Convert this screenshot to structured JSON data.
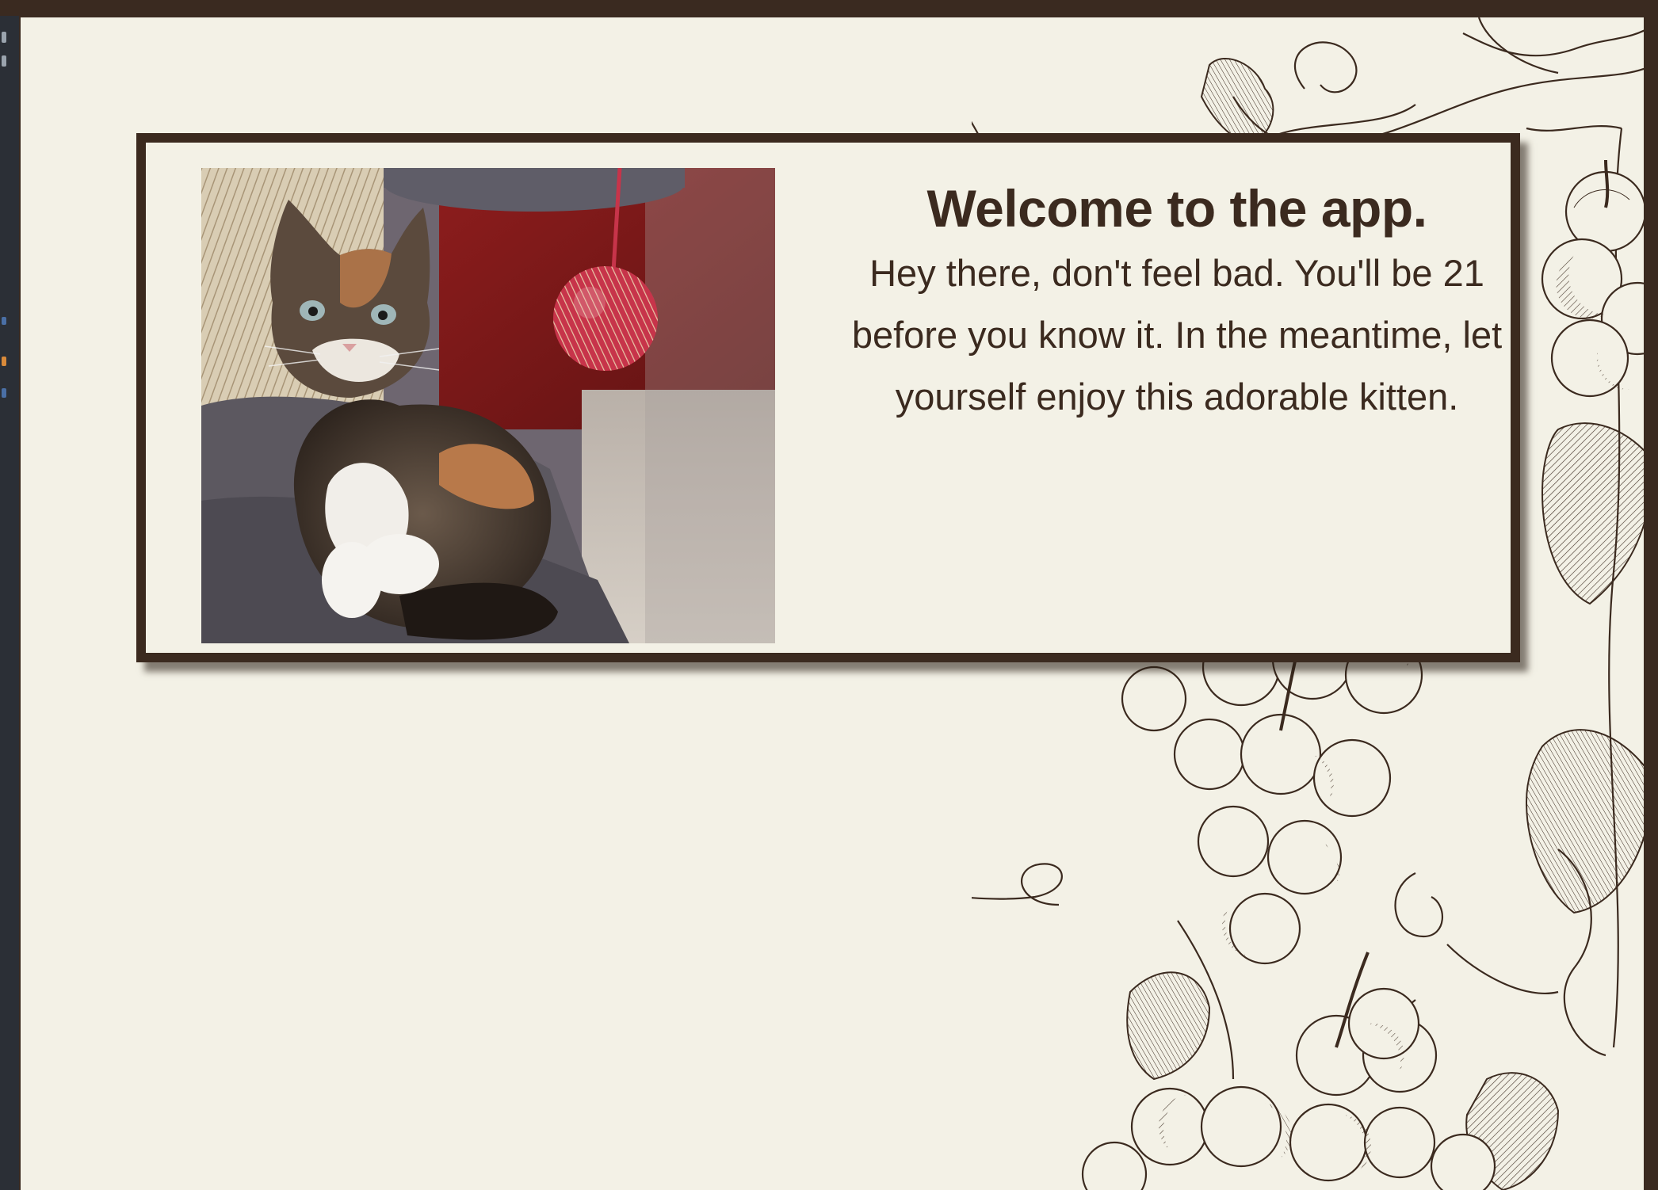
{
  "colors": {
    "frame": "#3a2a20",
    "background": "#f3f1e6",
    "text": "#3b2a1f",
    "card_border": "#3b2a1f"
  },
  "card": {
    "title": "Welcome to the app.",
    "message": "Hey there, don't feel bad. You'll be 21 before you know it. In the meantime, let yourself enjoy this adorable kitten."
  },
  "images": {
    "kitten": "kitten-photo",
    "background_art": "grape-vine-illustration"
  }
}
